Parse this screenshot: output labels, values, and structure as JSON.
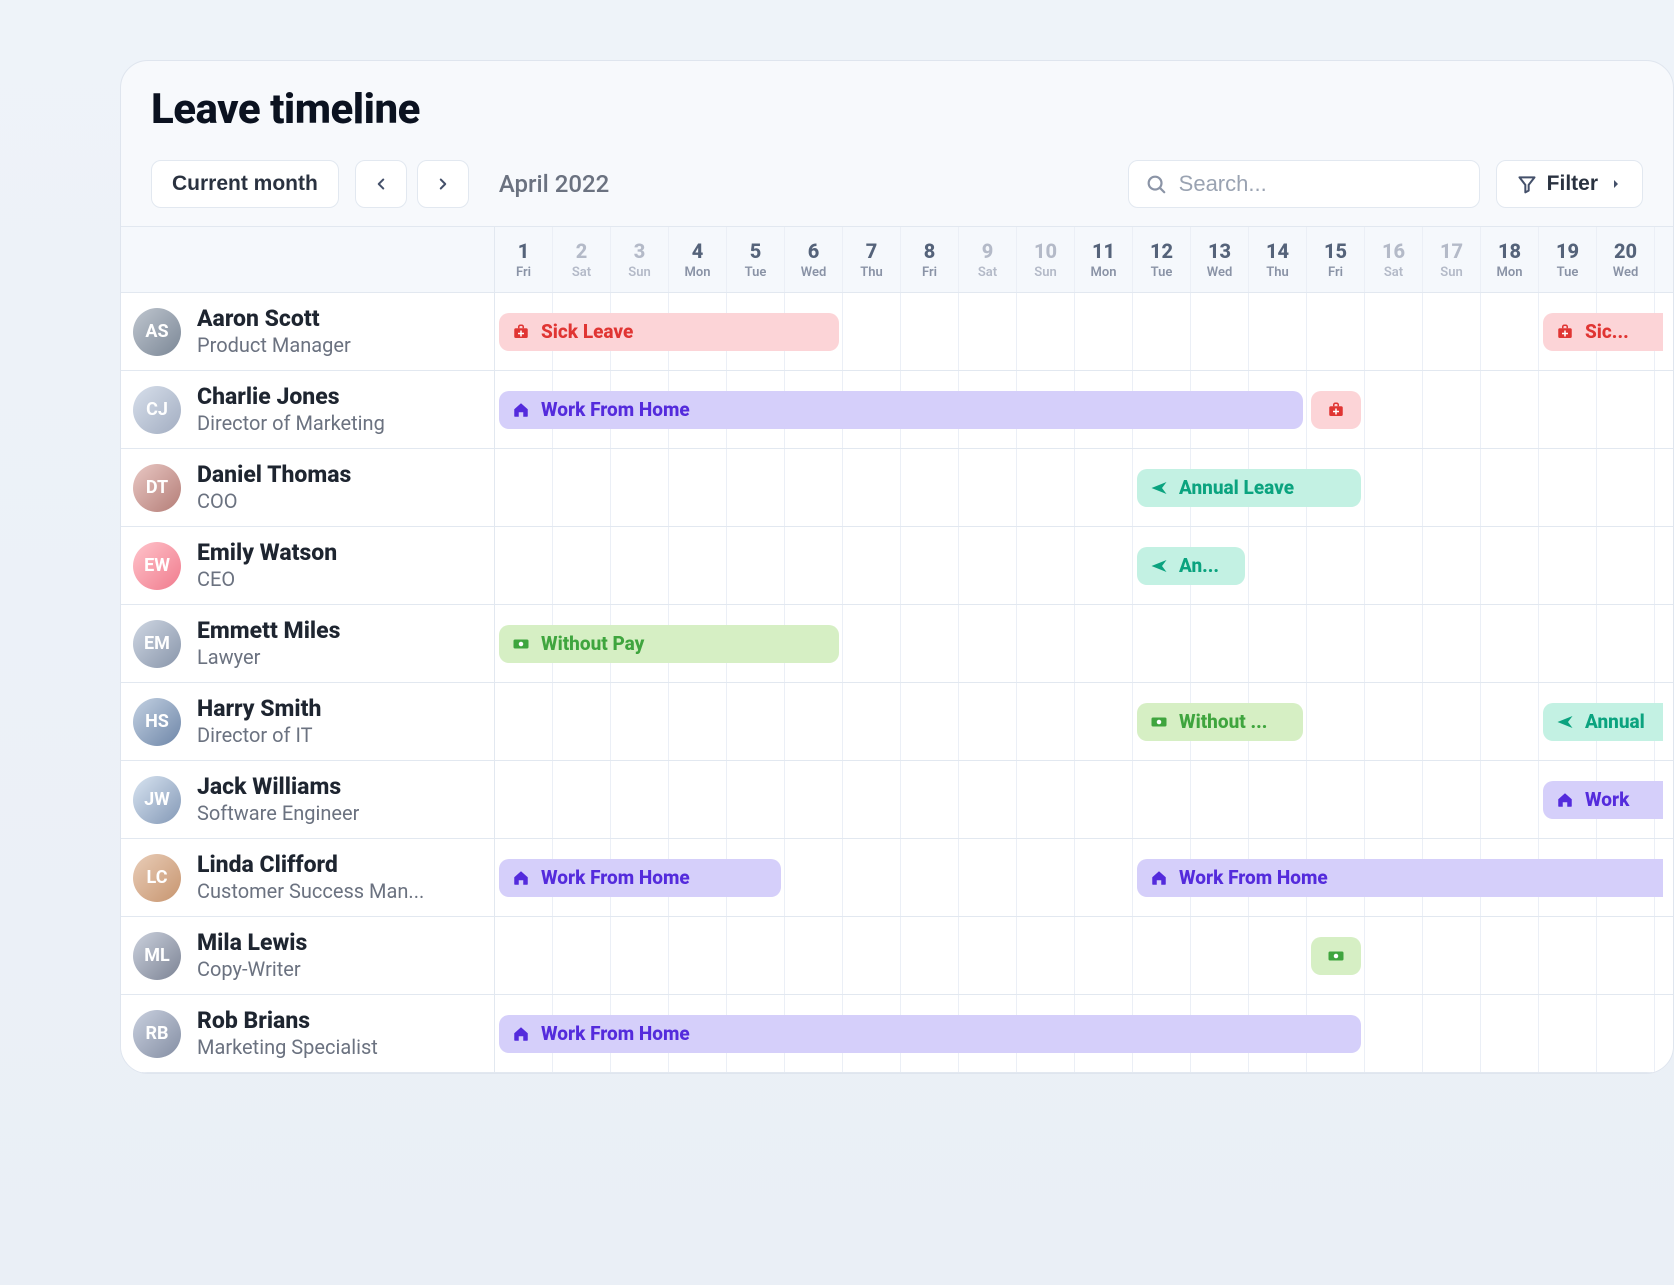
{
  "title": "Leave timeline",
  "toolbar": {
    "current_month_label": "Current month",
    "month_label": "April 2022",
    "filter_label": "Filter"
  },
  "search": {
    "placeholder": "Search..."
  },
  "days": [
    {
      "num": "1",
      "name": "Fri",
      "weekend": false
    },
    {
      "num": "2",
      "name": "Sat",
      "weekend": true
    },
    {
      "num": "3",
      "name": "Sun",
      "weekend": true
    },
    {
      "num": "4",
      "name": "Mon",
      "weekend": false
    },
    {
      "num": "5",
      "name": "Tue",
      "weekend": false
    },
    {
      "num": "6",
      "name": "Wed",
      "weekend": false
    },
    {
      "num": "7",
      "name": "Thu",
      "weekend": false
    },
    {
      "num": "8",
      "name": "Fri",
      "weekend": false
    },
    {
      "num": "9",
      "name": "Sat",
      "weekend": true
    },
    {
      "num": "10",
      "name": "Sun",
      "weekend": true
    },
    {
      "num": "11",
      "name": "Mon",
      "weekend": false
    },
    {
      "num": "12",
      "name": "Tue",
      "weekend": false
    },
    {
      "num": "13",
      "name": "Wed",
      "weekend": false
    },
    {
      "num": "14",
      "name": "Thu",
      "weekend": false
    },
    {
      "num": "15",
      "name": "Fri",
      "weekend": false
    },
    {
      "num": "16",
      "name": "Sat",
      "weekend": true
    },
    {
      "num": "17",
      "name": "Sun",
      "weekend": true
    },
    {
      "num": "18",
      "name": "Mon",
      "weekend": false
    },
    {
      "num": "19",
      "name": "Tue",
      "weekend": false
    },
    {
      "num": "20",
      "name": "Wed",
      "weekend": false
    }
  ],
  "leave_types": {
    "sick": {
      "label": "Sick Leave",
      "icon": "medkit",
      "css": "sick"
    },
    "wfh": {
      "label": "Work From Home",
      "icon": "home",
      "css": "wfh"
    },
    "annual": {
      "label": "Annual Leave",
      "icon": "plane",
      "css": "annual"
    },
    "withoutpay": {
      "label": "Without Pay",
      "icon": "cash",
      "css": "withoutpay"
    }
  },
  "people": [
    {
      "name": "Aaron Scott",
      "role": "Product Manager",
      "avatar": "av1",
      "events": [
        {
          "type": "sick",
          "start": 1,
          "end": 6,
          "label": "Sick Leave"
        },
        {
          "type": "sick",
          "start": 19,
          "end": 20,
          "label": "Sic...",
          "flush_right": true
        }
      ]
    },
    {
      "name": "Charlie Jones",
      "role": "Director of Marketing",
      "avatar": "av2",
      "events": [
        {
          "type": "wfh",
          "start": 1,
          "end": 14,
          "label": "Work From Home"
        },
        {
          "type": "sick",
          "start": 15,
          "end": 15,
          "label": "",
          "icon_only": true
        }
      ]
    },
    {
      "name": "Daniel Thomas",
      "role": "COO",
      "avatar": "av3",
      "events": [
        {
          "type": "annual",
          "start": 12,
          "end": 15,
          "label": "Annual Leave"
        }
      ]
    },
    {
      "name": "Emily Watson",
      "role": "CEO",
      "avatar": "av4",
      "events": [
        {
          "type": "annual",
          "start": 12,
          "end": 13,
          "label": "An..."
        }
      ]
    },
    {
      "name": "Emmett Miles",
      "role": "Lawyer",
      "avatar": "av5",
      "events": [
        {
          "type": "withoutpay",
          "start": 1,
          "end": 6,
          "label": "Without Pay"
        }
      ]
    },
    {
      "name": "Harry Smith",
      "role": "Director of IT",
      "avatar": "av6",
      "events": [
        {
          "type": "withoutpay",
          "start": 12,
          "end": 14,
          "label": "Without ..."
        },
        {
          "type": "annual",
          "start": 19,
          "end": 20,
          "label": "Annual",
          "flush_right": true
        }
      ]
    },
    {
      "name": "Jack Williams",
      "role": "Software Engineer",
      "avatar": "av7",
      "events": [
        {
          "type": "wfh",
          "start": 19,
          "end": 20,
          "label": "Work",
          "flush_right": true
        }
      ]
    },
    {
      "name": "Linda Clifford",
      "role": "Customer Success Man...",
      "avatar": "av8",
      "events": [
        {
          "type": "wfh",
          "start": 1,
          "end": 5,
          "label": "Work From Home"
        },
        {
          "type": "wfh",
          "start": 12,
          "end": 20,
          "label": "Work From Home",
          "flush_right": true
        }
      ]
    },
    {
      "name": "Mila Lewis",
      "role": "Copy-Writer",
      "avatar": "av9",
      "events": [
        {
          "type": "withoutpay",
          "start": 15,
          "end": 15,
          "label": "",
          "icon_only": true
        }
      ]
    },
    {
      "name": "Rob Brians",
      "role": "Marketing Specialist",
      "avatar": "av10",
      "events": [
        {
          "type": "wfh",
          "start": 1,
          "end": 15,
          "label": "Work From Home"
        }
      ]
    }
  ]
}
